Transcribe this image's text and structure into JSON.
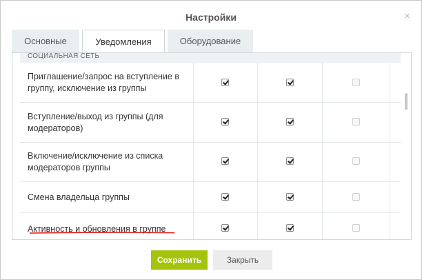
{
  "dialog": {
    "title": "Настройки",
    "close_glyph": "×",
    "tabs": [
      {
        "label": "Основные",
        "active": false
      },
      {
        "label": "Уведомления",
        "active": true
      },
      {
        "label": "Оборудование",
        "active": false
      }
    ]
  },
  "section": {
    "header": "СОЦИАЛЬНАЯ СЕТЬ",
    "rows": [
      {
        "label": "Приглашение/запрос на вступление в группу, исключение из группы",
        "col1": true,
        "col2": true,
        "col3": false
      },
      {
        "label": "Вступление/выход из группы (для модераторов)",
        "col1": true,
        "col2": true,
        "col3": false
      },
      {
        "label": "Включение/исключение из списка модераторов группы",
        "col1": true,
        "col2": true,
        "col3": false
      },
      {
        "label": "Смена владельца группы",
        "col1": true,
        "col2": true,
        "col3": false
      },
      {
        "label": "Активность и обновления в группе",
        "col1": true,
        "col2": true,
        "col3": false
      }
    ]
  },
  "buttons": {
    "save_label": "Сохранить",
    "close_label": "Закрыть"
  },
  "colors": {
    "save_button": "#a4c40c",
    "underline_annotation": "#e01010"
  }
}
